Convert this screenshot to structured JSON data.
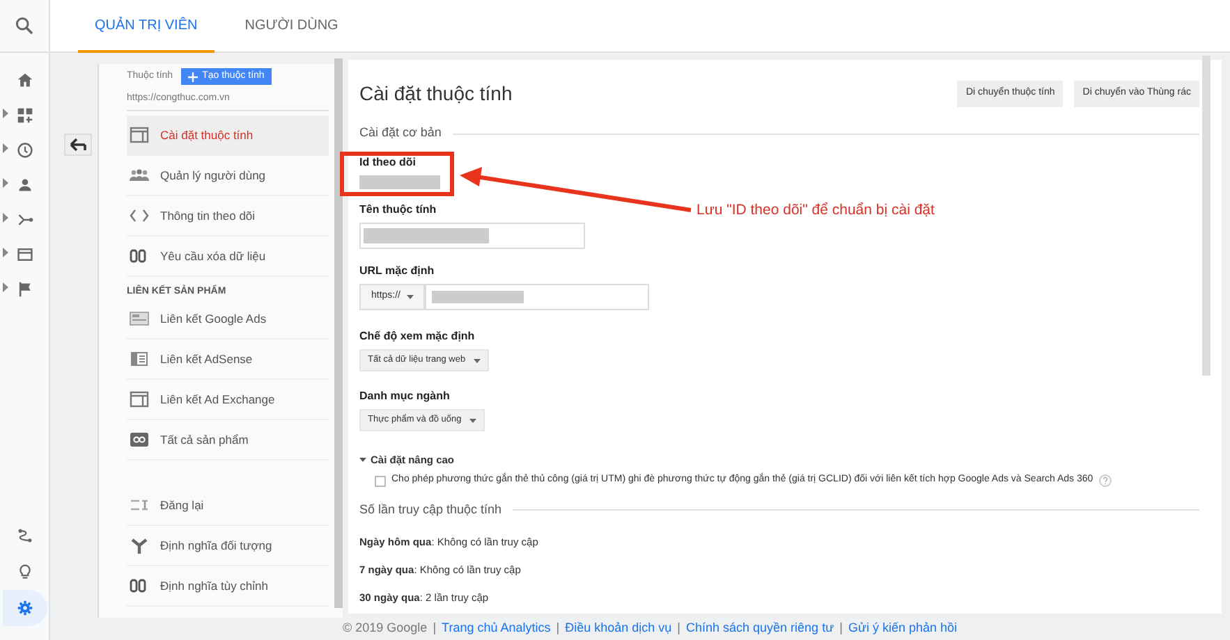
{
  "rail": {
    "items": [
      {
        "selected": false,
        "expandable": false
      },
      {
        "selected": false,
        "expandable": true
      },
      {
        "selected": false,
        "expandable": true
      },
      {
        "selected": false,
        "expandable": true
      },
      {
        "selected": false,
        "expandable": true
      },
      {
        "selected": false,
        "expandable": true
      },
      {
        "selected": false,
        "expandable": true
      }
    ],
    "bottom_items": [
      {
        "selected": false
      },
      {
        "selected": false
      },
      {
        "selected": true
      }
    ]
  },
  "tabs": [
    {
      "label": "QUẢN TRỊ VIÊN",
      "selected": true
    },
    {
      "label": "NGƯỜI DÙNG",
      "selected": false
    }
  ],
  "property": {
    "label": "Thuộc tính",
    "create_button": "Tạo thuộc tính",
    "url": "https://congthuc.com.vn"
  },
  "nav": {
    "groups": [
      {
        "items": [
          {
            "label": "Cài đặt thuộc tính",
            "selected": true
          },
          {
            "label": "Quản lý người dùng",
            "selected": false
          },
          {
            "label": "Thông tin theo dõi",
            "selected": false
          },
          {
            "label": "Yêu cầu xóa dữ liệu",
            "selected": false
          }
        ]
      },
      {
        "heading": "LIÊN KẾT SẢN PHẨM",
        "items": [
          {
            "label": "Liên kết Google Ads",
            "selected": false
          },
          {
            "label": "Liên kết AdSense",
            "selected": false
          },
          {
            "label": "Liên kết Ad Exchange",
            "selected": false
          },
          {
            "label": "Tất cả sản phẩm",
            "selected": false
          }
        ]
      },
      {
        "items": [
          {
            "label": "Đăng lại",
            "selected": false
          },
          {
            "label": "Định nghĩa đối tượng",
            "selected": false
          },
          {
            "label": "Định nghĩa tùy chỉnh",
            "selected": false
          }
        ]
      }
    ]
  },
  "main": {
    "title": "Cài đặt thuộc tính",
    "buttons": [
      "Di chuyển thuộc tính",
      "Di chuyển vào Thùng rác"
    ],
    "basic_heading": "Cài đặt cơ bản",
    "tracking_id": {
      "label": "Id theo dõi"
    },
    "property_name": {
      "label": "Tên thuộc tính"
    },
    "default_url": {
      "label": "URL mặc định",
      "protocol": "https://"
    },
    "default_view": {
      "label": "Chế độ xem mặc định",
      "value": "Tất cả dữ liệu trang web"
    },
    "industry": {
      "label": "Danh mục ngành",
      "value": "Thực phẩm và đồ uống"
    },
    "advanced": {
      "label": "Cài đặt nâng cao",
      "expanded": true,
      "option": {
        "label": "Cho phép phương thức gắn thẻ thủ công (giá trị UTM) ghi đè phương thức tự động gắn thẻ (giá trị GCLID) đối với liên kết tích hợp Google Ads và Search Ads 360",
        "checked": false
      }
    },
    "hits_heading": "Số lần truy cập thuộc tính",
    "hits": [
      "**Ngày hôm qua**: Không có lần truy cập",
      "**7 ngày qua**: Không có lần truy cập",
      "**30 ngày qua**: 2 lần truy cập"
    ]
  },
  "annotation": {
    "text": "Lưu \"ID theo dõi\" để chuẩn bị cài đặt"
  },
  "footer": [
    {
      "kind": "text",
      "text": "© 2019 Google"
    },
    {
      "kind": "separator",
      "text": "|"
    },
    {
      "kind": "link",
      "text": "Trang chủ Analytics"
    },
    {
      "kind": "separator",
      "text": "|"
    },
    {
      "kind": "link",
      "text": "Điều khoản dịch vụ"
    },
    {
      "kind": "separator",
      "text": "|"
    },
    {
      "kind": "link",
      "text": "Chính sách quyền riêng tư"
    },
    {
      "kind": "separator",
      "text": "|"
    },
    {
      "kind": "link",
      "text": "Gửi ý kiến phản hồi"
    }
  ]
}
